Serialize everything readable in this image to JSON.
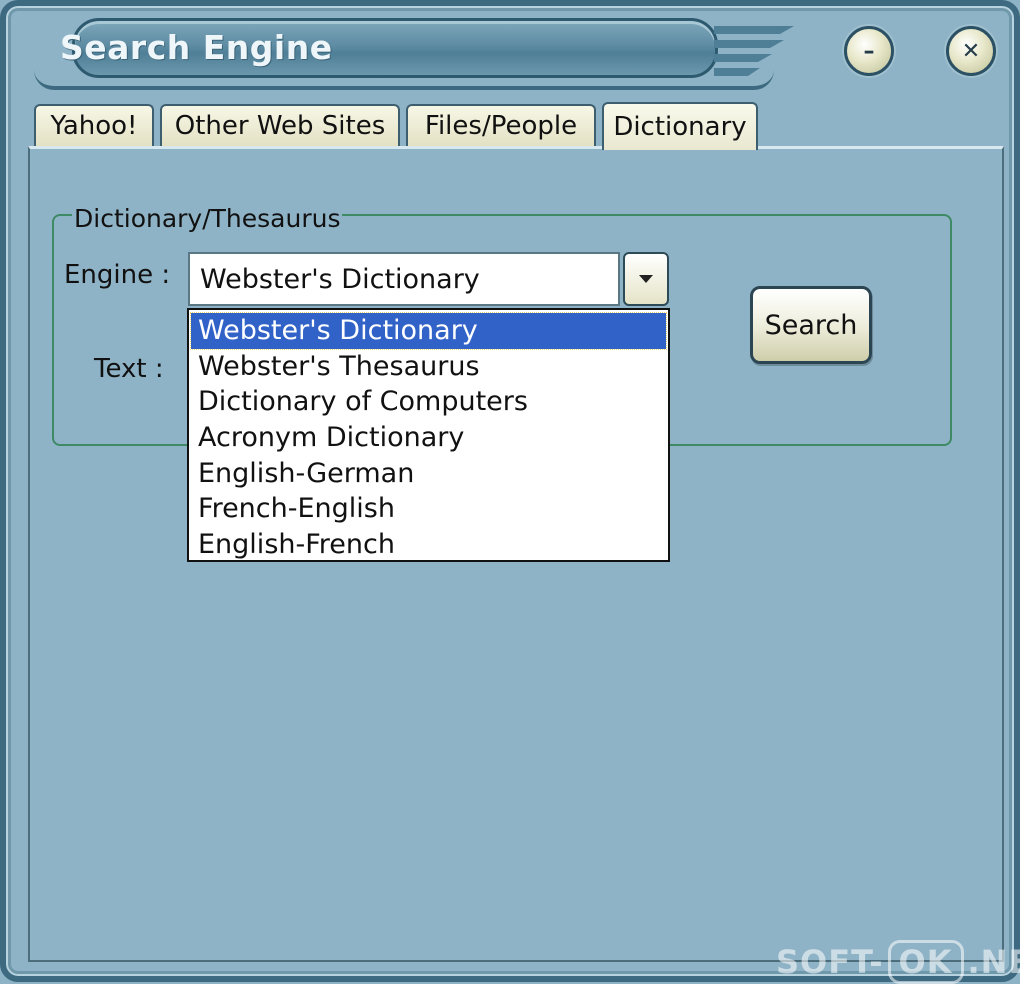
{
  "window": {
    "title": "Search Engine",
    "minimize_glyph": "–",
    "close_glyph": "✕"
  },
  "tabs": [
    {
      "label": "Yahoo!"
    },
    {
      "label": "Other Web Sites"
    },
    {
      "label": "Files/People"
    },
    {
      "label": "Dictionary",
      "active": true
    }
  ],
  "dictionary": {
    "group_label": "Dictionary/Thesaurus",
    "engine_label": "Engine :",
    "text_label": "Text :",
    "engine_value": "Webster's Dictionary",
    "search_button": "Search",
    "options": [
      "Webster's Dictionary",
      "Webster's Thesaurus",
      "Dictionary of Computers",
      "Acronym Dictionary",
      "English-German",
      "French-English",
      "English-French"
    ],
    "selected_index": 0
  },
  "watermark": {
    "left": "SOFT-",
    "middle": "OK",
    "right": ".NET"
  },
  "colors": {
    "background": "#8fb3c6",
    "selection": "#3162c8",
    "group_border": "#3d8a65"
  }
}
